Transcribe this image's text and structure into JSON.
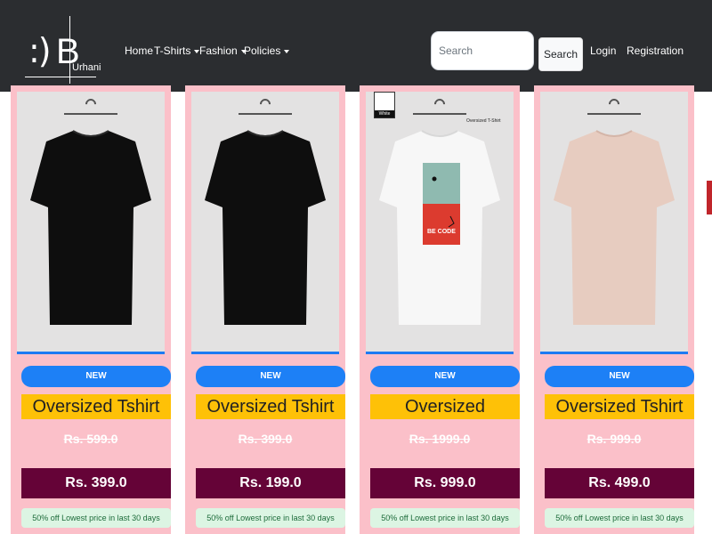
{
  "brand": {
    "face": ":)",
    "letter": "B",
    "sub": "Urhani"
  },
  "nav": {
    "home": "Home",
    "tshirts": "T-Shirts",
    "fashion": "Fashion",
    "policies": "Policies"
  },
  "search": {
    "placeholder": "Search",
    "button": "Search"
  },
  "auth": {
    "login": "Login",
    "registration": "Registration"
  },
  "colors": {
    "navbar": "#2b2d30",
    "card_bg": "#fbc0c9",
    "badge": "#1d80f6",
    "title_bg": "#fec107",
    "price_bg": "#650337",
    "offer_bg": "#dcf5e3"
  },
  "products": [
    {
      "badge": "NEW",
      "title": "Oversized Tshirt",
      "old_price": "Rs. 599.0",
      "price": "Rs. 399.0",
      "offer": "50% off Lowest price in last 30 days",
      "shirt_color": "#0e0e0e"
    },
    {
      "badge": "NEW",
      "title": "Oversized Tshirt",
      "old_price": "Rs. 399.0",
      "price": "Rs. 199.0",
      "offer": "50% off Lowest price in last 30 days",
      "shirt_color": "#0e0e0e"
    },
    {
      "badge": "NEW",
      "title": "Oversized",
      "old_price": "Rs. 1999.0",
      "price": "Rs. 999.0",
      "offer": "50% off Lowest price in last 30 days",
      "shirt_color": "#f7f7f7",
      "tag_label": "White",
      "callout": "Oversized T-Shirt",
      "print_text": "BE CODE"
    },
    {
      "badge": "NEW",
      "title": "Oversized Tshirt",
      "old_price": "Rs. 999.0",
      "price": "Rs. 499.0",
      "offer": "50% off Lowest price in last 30 days",
      "shirt_color": "#e7ccc0"
    }
  ]
}
